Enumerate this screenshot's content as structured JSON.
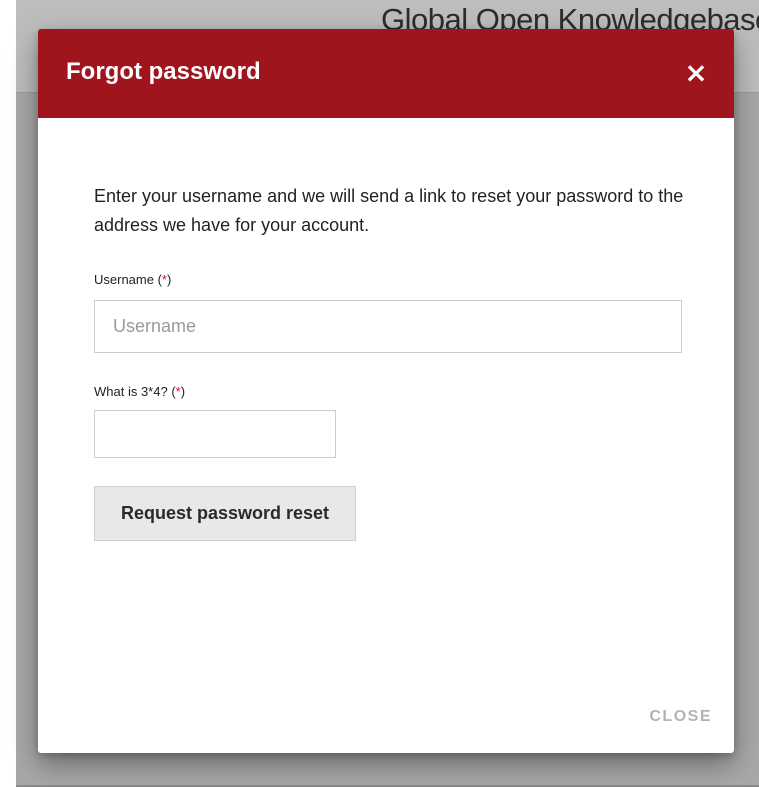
{
  "background": {
    "tagline": "Global Open Knowledgebase"
  },
  "modal": {
    "title": "Forgot password",
    "close_icon": "×",
    "intro": "Enter your username and we will send a link to reset your password to the address we have for your account.",
    "username": {
      "label": "Username",
      "required_marker": "*",
      "placeholder": "Username",
      "value": ""
    },
    "captcha": {
      "label": "What is 3*4?",
      "required_marker": "*",
      "value": ""
    },
    "submit_label": "Request password reset",
    "close_label": "CLOSE"
  },
  "colors": {
    "header": "#a0141e",
    "required": "#d01020"
  }
}
